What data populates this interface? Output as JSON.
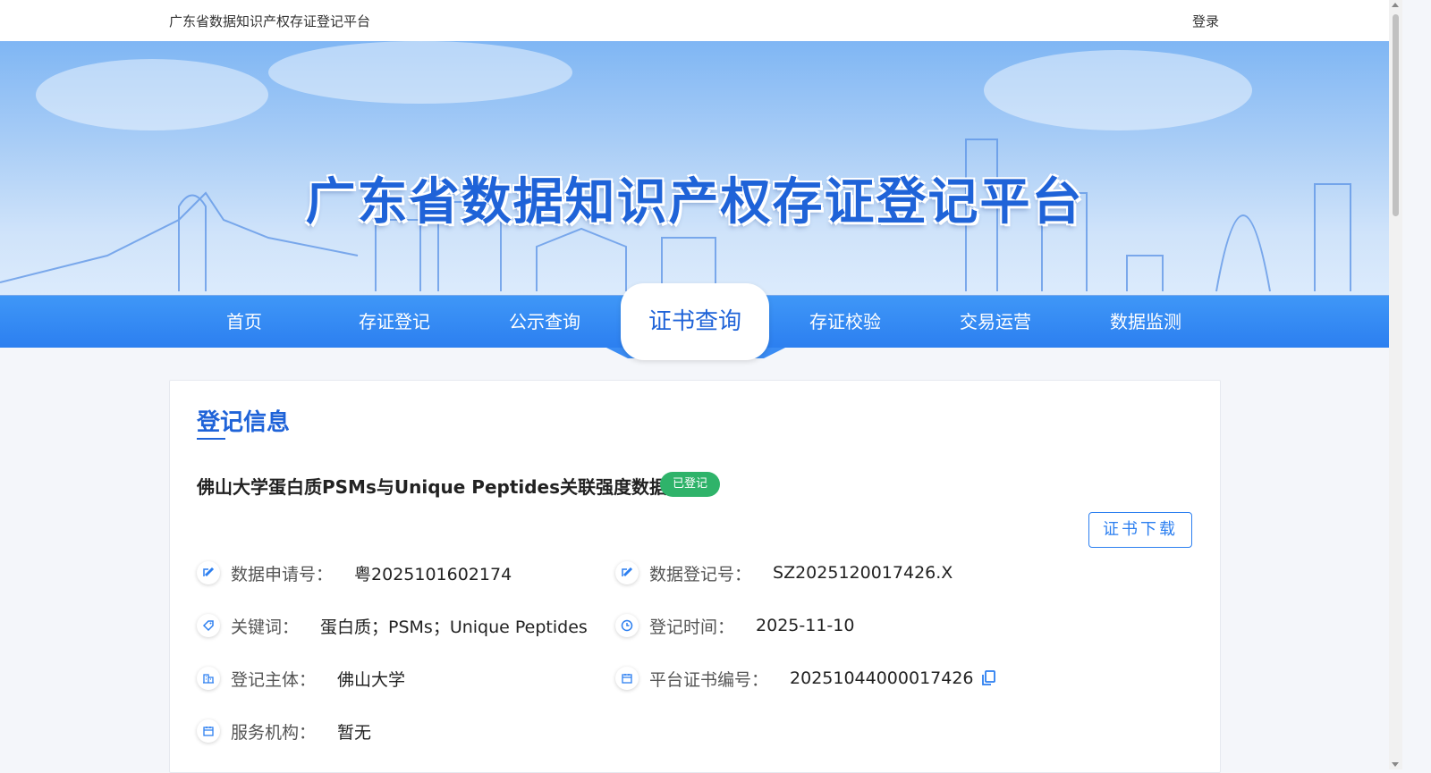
{
  "topbar": {
    "site_name": "广东省数据知识产权存证登记平台",
    "login_label": "登录"
  },
  "banner": {
    "hero_title": "广东省数据知识产权存证登记平台"
  },
  "nav": {
    "items": [
      {
        "label": "首页"
      },
      {
        "label": "存证登记"
      },
      {
        "label": "公示查询"
      },
      {
        "label": "证书查询",
        "active": true
      },
      {
        "label": "存证校验"
      },
      {
        "label": "交易运营"
      },
      {
        "label": "数据监测"
      }
    ]
  },
  "section": {
    "title": "登记信息"
  },
  "record": {
    "title": "佛山大学蛋白质PSMs与Unique Peptides关联强度数据集",
    "status": "已登记",
    "download_label": "证书下载",
    "fields": {
      "application_no_label": "数据申请号：",
      "application_no": "粤2025101602174",
      "registration_no_label": "数据登记号：",
      "registration_no": "SZ2025120017426.X",
      "keywords_label": "关键词：",
      "keywords": "蛋白质；PSMs；Unique Peptides",
      "reg_time_label": "登记时间：",
      "reg_time": "2025-11-10",
      "subject_label": "登记主体：",
      "subject": "佛山大学",
      "cert_no_label": "平台证书编号：",
      "cert_no": "20251044000017426",
      "service_org_label": "服务机构：",
      "service_org": "暂无"
    }
  },
  "colors": {
    "primary": "#2c7ff0",
    "title_blue": "#1f63d8",
    "status_green": "#2fb36a"
  }
}
